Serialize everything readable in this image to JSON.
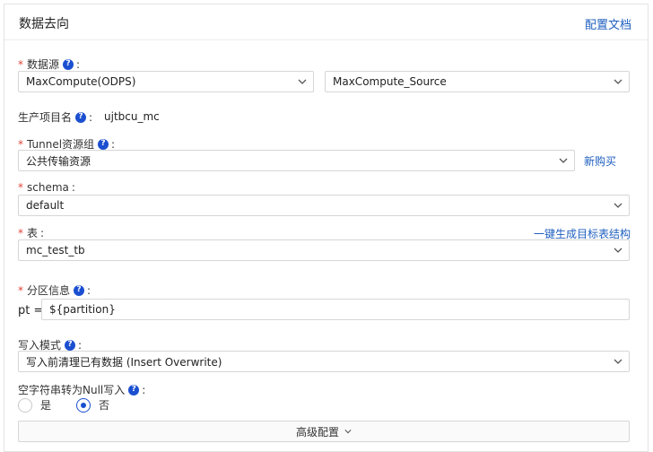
{
  "header": {
    "title": "数据去向",
    "doc_link": "配置文档"
  },
  "icons": {
    "help": "help-circle-icon",
    "chevron": "chevron-down-icon"
  },
  "colors": {
    "accent": "#1b4fd0",
    "link": "#1f5fbf",
    "required": "#e0463c"
  },
  "datasource": {
    "label": "数据源",
    "type_value": "MaxCompute(ODPS)",
    "source_value": "MaxCompute_Source"
  },
  "project": {
    "label": "生产项目名",
    "value": "ujtbcu_mc"
  },
  "tunnel": {
    "label": "Tunnel资源组",
    "value": "公共传输资源",
    "buy_link": "新购买"
  },
  "schema": {
    "label": "schema",
    "value": "default"
  },
  "table": {
    "label": "表",
    "value": "mc_test_tb",
    "generate_link": "一键生成目标表结构"
  },
  "partition": {
    "label": "分区信息",
    "key": "pt =",
    "value": "${partition}"
  },
  "write_mode": {
    "label": "写入模式",
    "value": "写入前清理已有数据 (Insert Overwrite)"
  },
  "null_write": {
    "label": "空字符串转为Null写入",
    "options": [
      {
        "label": "是",
        "checked": false
      },
      {
        "label": "否",
        "checked": true
      }
    ]
  },
  "advanced": {
    "label": "高级配置"
  }
}
